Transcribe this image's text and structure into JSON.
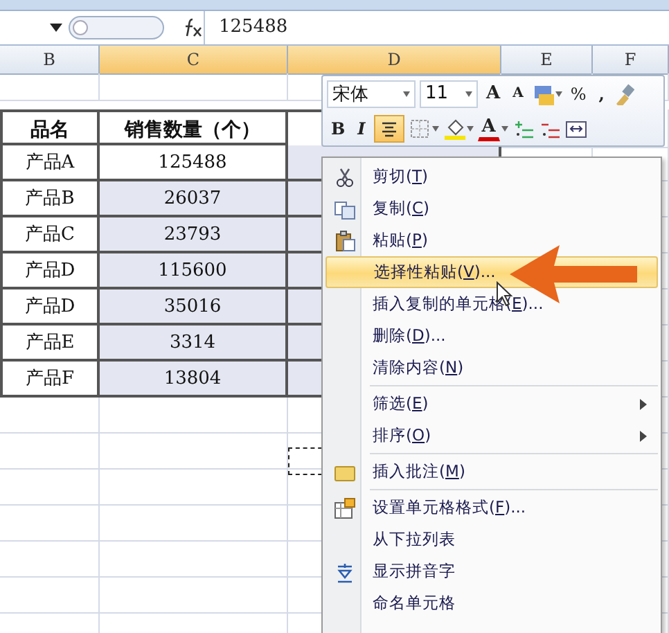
{
  "formula_bar": {
    "value": "125488"
  },
  "columns": [
    {
      "label": "B",
      "selected": false
    },
    {
      "label": "C",
      "selected": true
    },
    {
      "label": "D",
      "selected": true
    },
    {
      "label": "E",
      "selected": false
    },
    {
      "label": "F",
      "selected": false
    }
  ],
  "table": {
    "header": [
      "品名",
      "销售数量（个）"
    ],
    "rows": [
      {
        "name": "产品A",
        "quantity": "125488",
        "active": true
      },
      {
        "name": "产品B",
        "quantity": "26037",
        "active": false
      },
      {
        "name": "产品C",
        "quantity": "23793",
        "active": false
      },
      {
        "name": "产品D",
        "quantity": "115600",
        "active": false
      },
      {
        "name": "产品D",
        "quantity": "35016",
        "active": false
      },
      {
        "name": "产品E",
        "quantity": "3314",
        "active": false
      },
      {
        "name": "产品F",
        "quantity": "13804",
        "active": false
      }
    ]
  },
  "mini_toolbar": {
    "row_1": [
      {
        "kind": "font",
        "text": "宋体"
      },
      {
        "kind": "size",
        "text": "11"
      },
      {
        "kind": "grow",
        "text": "A"
      },
      {
        "kind": "shrink",
        "text": "A"
      },
      {
        "kind": "style"
      },
      {
        "kind": "percent",
        "text": "%"
      },
      {
        "kind": "comma",
        "text": ","
      },
      {
        "kind": "painter"
      }
    ],
    "row_2": [
      {
        "kind": "bold",
        "text": "B",
        "on": false
      },
      {
        "kind": "italic",
        "text": "I",
        "on": false
      },
      {
        "kind": "center",
        "on": true
      },
      {
        "kind": "border"
      },
      {
        "kind": "fill"
      },
      {
        "kind": "font_color",
        "text": "A"
      },
      {
        "kind": "inc_decimal"
      },
      {
        "kind": "dec_decimal"
      },
      {
        "kind": "merge"
      }
    ]
  },
  "context_menu": {
    "items": [
      {
        "kind": "cut",
        "before": "剪切(",
        "key": "T",
        "after": ")",
        "selected": false
      },
      {
        "kind": "copy",
        "before": "复制(",
        "key": "C",
        "after": ")",
        "selected": false
      },
      {
        "kind": "paste",
        "before": "粘贴(",
        "key": "P",
        "after": ")",
        "selected": false
      },
      {
        "kind": "command",
        "before": "选择性粘贴(",
        "key": "V",
        "after": ")...",
        "selected": true
      },
      {
        "kind": "command",
        "before": "插入复制的单元格(",
        "key": "E",
        "after": ")...",
        "selected": false
      },
      {
        "kind": "command",
        "before": "删除(",
        "key": "D",
        "after": ")...",
        "selected": false
      },
      {
        "kind": "command",
        "before": "清除内容(",
        "key": "N",
        "after": ")",
        "selected": false
      },
      {
        "kind": "separator"
      },
      {
        "kind": "command",
        "before": "筛选(",
        "key": "E",
        "after": ")",
        "submenu": true,
        "selected": false
      },
      {
        "kind": "command",
        "before": "排序(",
        "key": "O",
        "after": ")",
        "submenu": true,
        "selected": false
      },
      {
        "kind": "separator"
      },
      {
        "kind": "comment",
        "before": "插入批注(",
        "key": "M",
        "after": ")",
        "selected": false
      },
      {
        "kind": "separator"
      },
      {
        "kind": "format",
        "before": "设置单元格格式(",
        "key": "F",
        "after": ")...",
        "selected": false
      },
      {
        "kind": "command",
        "before": "从下拉列表",
        "selected": false
      },
      {
        "kind": "phonetic",
        "before": "显示拼音字",
        "selected": false
      },
      {
        "kind": "command",
        "before": "命名单元格",
        "selected": false
      }
    ]
  }
}
